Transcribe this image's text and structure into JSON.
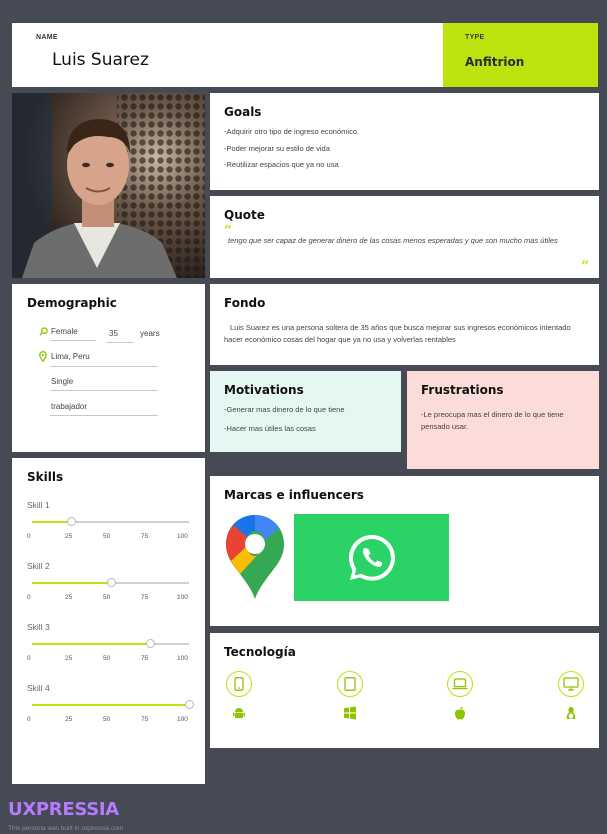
{
  "header": {
    "name_label": "NAME",
    "name": "Luis Suarez",
    "type_label": "TYPE",
    "type_value": "Anfitrion"
  },
  "goals": {
    "title": "Goals",
    "items": [
      "-Adquirir otro tipo de ingreso económico.",
      "-Poder mejorar su estilo de vida",
      "-Reutilizar espacios que ya no usa"
    ]
  },
  "quote": {
    "title": "Quote",
    "text": "tengo que ser capaz de generar dinero de las cosas menos esperadas y que son mucho mas útiles"
  },
  "demographic": {
    "title": "Demographic",
    "gender": "Female",
    "age": "35",
    "age_unit": "years",
    "location": "Lima, Peru",
    "status": "Single",
    "occupation": "trabajador"
  },
  "fondo": {
    "title": "Fondo",
    "text": "Luis Suarez es una persona soltera de 35 años que busca mejorar sus ingresos económicos intentado hacer económico cosas del hogar que ya no usa y volverlas rentables"
  },
  "motivations": {
    "title": "Motivations",
    "items": [
      "-Generar mas dinero de lo que tiene",
      "-Hacer mas útiles las cosas"
    ]
  },
  "frustrations": {
    "title": "Frustrations",
    "text": "-Le preocupa mas el dinero de lo que tiene pensado usar."
  },
  "skills": {
    "title": "Skills",
    "scale": [
      "0",
      "25",
      "50",
      "75",
      "100"
    ],
    "items": [
      {
        "name": "Skill 1",
        "value": 25
      },
      {
        "name": "Skill 2",
        "value": 50
      },
      {
        "name": "Skill 3",
        "value": 75
      },
      {
        "name": "Skill 4",
        "value": 100
      }
    ],
    "colors": {
      "fill": "#bde30f",
      "track": "#cfcfcf"
    }
  },
  "marcas": {
    "title": "Marcas e influencers",
    "brands": [
      "google-maps-icon",
      "whatsapp-icon"
    ]
  },
  "tecnologia": {
    "title": "Tecnología",
    "devices": [
      "phone-icon",
      "tablet-icon",
      "laptop-icon",
      "desktop-icon"
    ],
    "platforms": [
      "android-icon",
      "windows-icon",
      "apple-icon",
      "linux-icon"
    ]
  },
  "footer": {
    "brand": "UXPRESSIA",
    "note": "This persona was built in uxpressia.com"
  },
  "colors": {
    "accent": "#bde30f",
    "background": "#464a55",
    "motivations_bg": "#e5f7f3",
    "frustrations_bg": "#fbdcd8",
    "brand": "#b57bff"
  }
}
